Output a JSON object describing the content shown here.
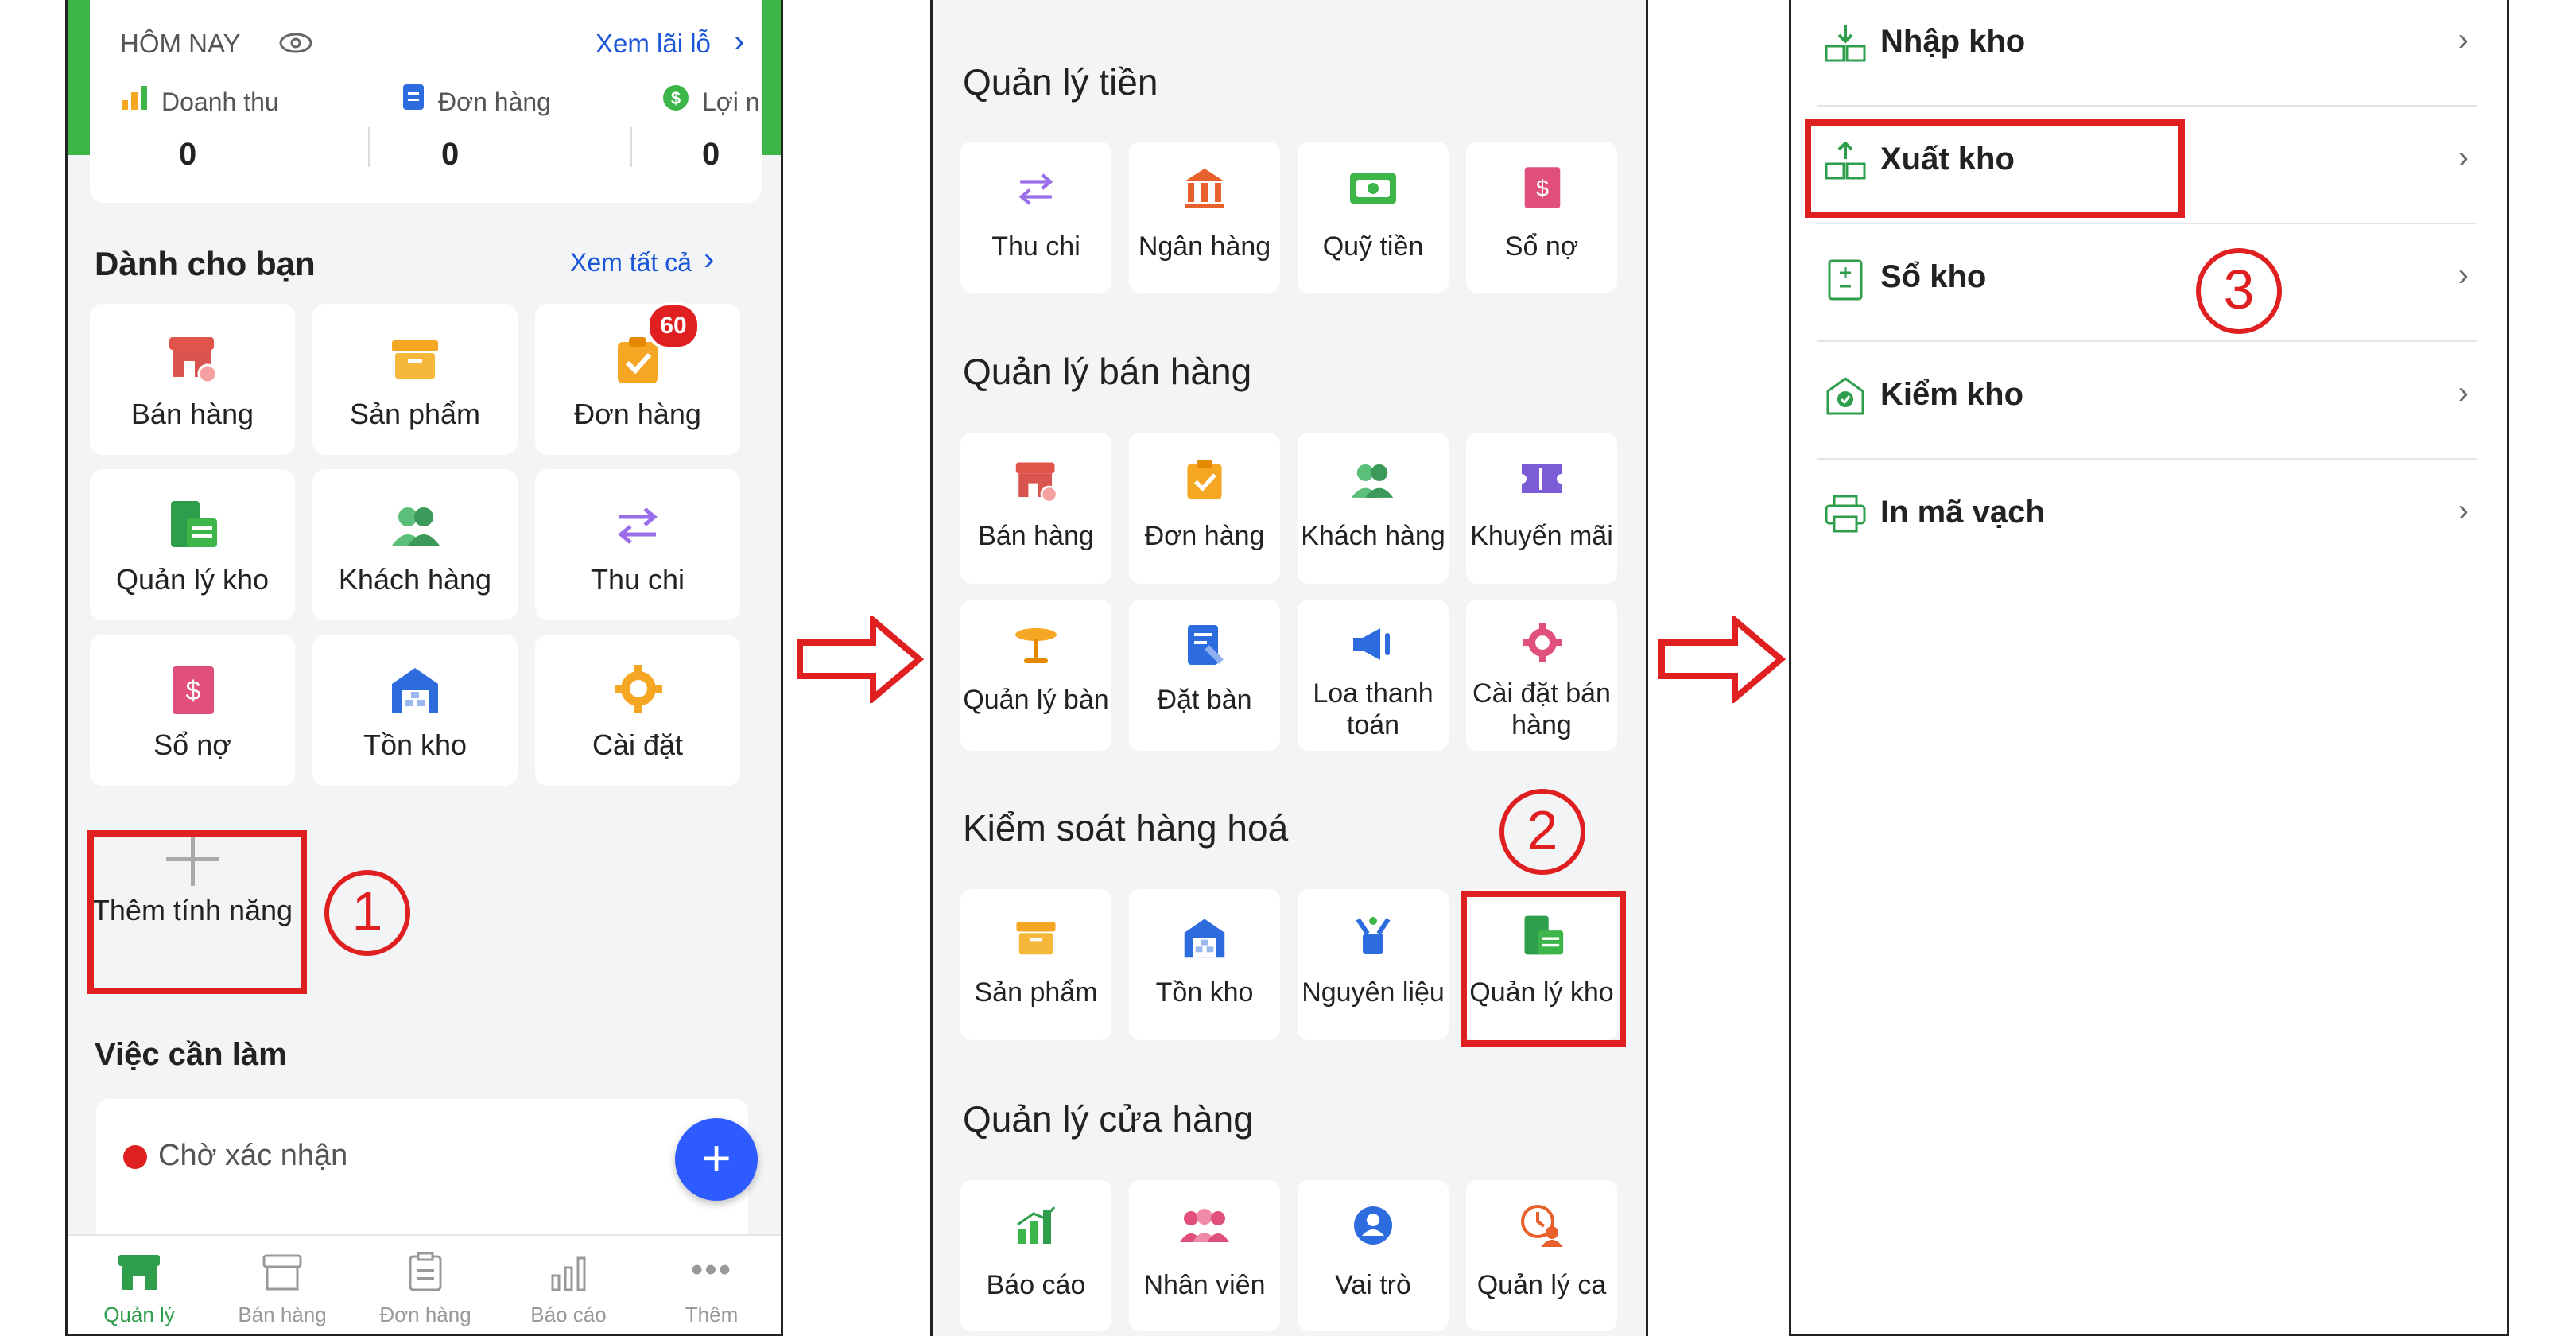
{
  "panel1": {
    "today": {
      "title": "HÔM NAY",
      "profit_link": "Xem lãi lỗ",
      "stats": [
        {
          "label": "Doanh thu",
          "value": "0"
        },
        {
          "label": "Đơn hàng",
          "value": "0"
        },
        {
          "label": "Lợi n",
          "value": "0"
        }
      ]
    },
    "for_you": {
      "title": "Dành cho bạn",
      "see_all": "Xem tất cả",
      "tiles": [
        {
          "label": "Bán hàng",
          "icon": "store-icon"
        },
        {
          "label": "Sản phẩm",
          "icon": "box-icon"
        },
        {
          "label": "Đơn hàng",
          "icon": "clipboard-check-icon",
          "badge": "60"
        },
        {
          "label": "Quản lý kho",
          "icon": "warehouse-icon"
        },
        {
          "label": "Khách hàng",
          "icon": "customers-icon"
        },
        {
          "label": "Thu chi",
          "icon": "transfer-arrows-icon"
        },
        {
          "label": "Sổ nợ",
          "icon": "debt-book-icon"
        },
        {
          "label": "Tồn kho",
          "icon": "stock-building-icon"
        },
        {
          "label": "Cài đặt",
          "icon": "gear-icon"
        }
      ],
      "add_feature": "Thêm tính năng"
    },
    "todo": {
      "title": "Việc cần làm",
      "pending": "Chờ xác nhận"
    },
    "bottom_nav": [
      {
        "label": "Quản lý",
        "icon": "store-manage-icon",
        "active": true
      },
      {
        "label": "Bán hàng",
        "icon": "store-outline-icon"
      },
      {
        "label": "Đơn hàng",
        "icon": "clipboard-outline-icon"
      },
      {
        "label": "Báo cáo",
        "icon": "chart-outline-icon"
      },
      {
        "label": "Thêm",
        "icon": "more-dots-icon"
      }
    ]
  },
  "panel2": {
    "sections": [
      {
        "title": "Quản lý tiền",
        "tiles": [
          "Thu chi",
          "Ngân hàng",
          "Quỹ tiền",
          "Sổ nợ"
        ]
      },
      {
        "title": "Quản lý bán hàng",
        "tiles": [
          "Bán hàng",
          "Đơn hàng",
          "Khách hàng",
          "Khuyến mãi",
          "Quản lý bàn",
          "Đặt bàn",
          "Loa thanh toán",
          "Cài đặt bán hàng"
        ]
      },
      {
        "title": "Kiểm soát hàng hoá",
        "tiles": [
          "Sản phẩm",
          "Tồn kho",
          "Nguyên liệu",
          "Quản lý kho"
        ]
      },
      {
        "title": "Quản lý cửa hàng",
        "tiles": [
          "Báo cáo",
          "Nhân viên",
          "Vai trò",
          "Quản lý ca"
        ]
      }
    ]
  },
  "panel3": {
    "items": [
      "Nhập kho",
      "Xuất kho",
      "Sổ kho",
      "Kiểm kho",
      "In mã vạch"
    ],
    "chevron": "›"
  },
  "steps": [
    "1",
    "2",
    "3"
  ],
  "colors": {
    "green": "#3cb649",
    "red_annotation": "#e02020",
    "link_blue": "#1a56d6",
    "fab_blue": "#2d5bff",
    "orange": "#f5a623"
  }
}
